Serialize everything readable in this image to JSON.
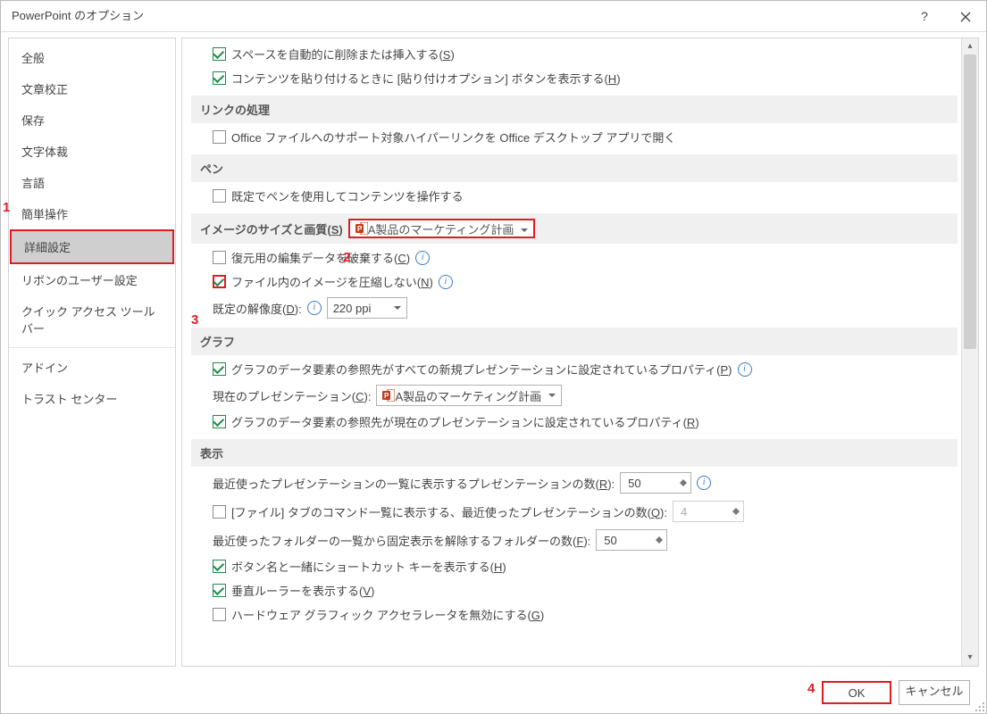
{
  "window": {
    "title": "PowerPoint のオプション"
  },
  "sidebar": {
    "items": [
      {
        "label": "全般"
      },
      {
        "label": "文章校正"
      },
      {
        "label": "保存"
      },
      {
        "label": "文字体裁"
      },
      {
        "label": "言語"
      },
      {
        "label": "簡単操作"
      },
      {
        "label": "詳細設定",
        "selected": true
      },
      {
        "label": "リボンのユーザー設定"
      },
      {
        "label": "クイック アクセス ツール バー"
      },
      {
        "label": "アドイン"
      },
      {
        "label": "トラスト センター"
      }
    ]
  },
  "options": {
    "auto_space": {
      "label": "スペースを自動的に削除または挿入する",
      "accel": "S",
      "checked": true
    },
    "paste_options": {
      "label": "コンテンツを貼り付けるときに [貼り付けオプション] ボタンを表示する",
      "accel": "H",
      "checked": true
    },
    "section_link": "リンクの処理",
    "office_hyperlink": {
      "label": "Office ファイルへのサポート対象ハイパーリンクを Office デスクトップ アプリで開く",
      "checked": false
    },
    "section_pen": "ペン",
    "use_pen_default": {
      "label": "既定でペンを使用してコンテンツを操作する",
      "checked": false
    },
    "section_image": {
      "label": "イメージのサイズと画質",
      "accel": "S"
    },
    "image_target": {
      "value": "A製品のマーケティング計画"
    },
    "discard_edit": {
      "label": "復元用の編集データを破棄する",
      "accel": "C",
      "checked": false
    },
    "no_compress": {
      "label": "ファイル内のイメージを圧縮しない",
      "accel": "N",
      "checked": true
    },
    "default_res_label": "既定の解像度",
    "default_res_accel": "D",
    "default_res_value": "220 ppi",
    "section_graph": "グラフ",
    "graph_props_new": {
      "label": "グラフのデータ要素の参照先がすべての新規プレゼンテーションに設定されているプロパティ",
      "accel": "P",
      "checked": true
    },
    "current_pres_label": "現在のプレゼンテーション",
    "current_pres_accel": "C",
    "current_pres_value": "A製品のマーケティング計画",
    "graph_props_cur": {
      "label": "グラフのデータ要素の参照先が現在のプレゼンテーションに設定されているプロパティ",
      "accel": "R",
      "checked": true
    },
    "section_display": "表示",
    "recent_count": {
      "label": "最近使ったプレゼンテーションの一覧に表示するプレゼンテーションの数",
      "accel": "R",
      "value": "50"
    },
    "quick_access_count": {
      "label": "[ファイル] タブのコマンド一覧に表示する、最近使ったプレゼンテーションの数",
      "accel": "Q",
      "checked": false,
      "value": "4"
    },
    "unpin_count": {
      "label": "最近使ったフォルダーの一覧から固定表示を解除するフォルダーの数",
      "accel": "F",
      "value": "50"
    },
    "show_shortcut": {
      "label": "ボタン名と一緒にショートカット キーを表示する",
      "accel": "H",
      "checked": true
    },
    "show_ruler": {
      "label": "垂直ルーラーを表示する",
      "accel": "V",
      "checked": true
    },
    "disable_hw": {
      "label": "ハードウェア グラフィック アクセラレータを無効にする",
      "accel": "G",
      "checked": false
    }
  },
  "footer": {
    "ok": "OK",
    "cancel": "キャンセル"
  },
  "markers": {
    "m1": "1",
    "m2": "2",
    "m3": "3",
    "m4": "4"
  }
}
